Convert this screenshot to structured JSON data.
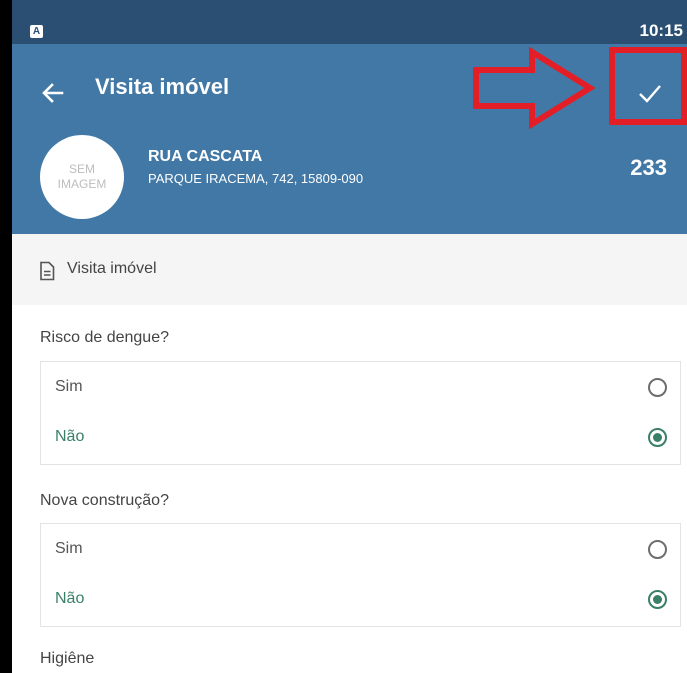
{
  "status_bar": {
    "app_icon_glyph": "A",
    "time": "10:15"
  },
  "header": {
    "title": "Visita imóvel",
    "back_icon": "arrow-left-icon",
    "confirm_icon": "check-icon",
    "avatar_line1": "SEM",
    "avatar_line2": "IMAGEM",
    "street": "RUA CASCATA",
    "address": "PARQUE IRACEMA, 742, 15809-090",
    "number": "233"
  },
  "annotation": {
    "color": "#e41e26"
  },
  "section": {
    "icon": "document-icon",
    "label": "Visita imóvel"
  },
  "questions": [
    {
      "label": "Risco de dengue?",
      "options": [
        {
          "label": "Sim",
          "selected": false
        },
        {
          "label": "Não",
          "selected": true
        }
      ]
    },
    {
      "label": "Nova construção?",
      "options": [
        {
          "label": "Sim",
          "selected": false
        },
        {
          "label": "Não",
          "selected": true
        }
      ]
    },
    {
      "label": "Higiêne"
    }
  ],
  "colors": {
    "status_bar": "#2b4f73",
    "header": "#4278a5",
    "accent": "#3a7f68",
    "section_bg": "#f5f5f5"
  }
}
